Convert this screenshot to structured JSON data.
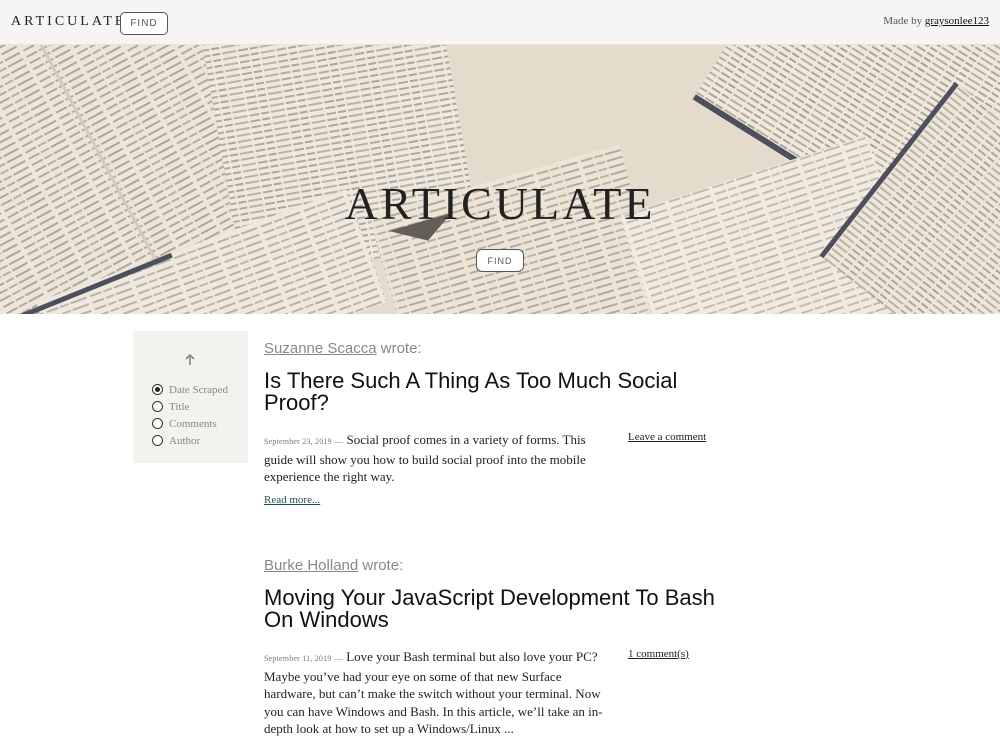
{
  "nav": {
    "brand": "ARTICULATE",
    "find_label": "FIND",
    "made_by_prefix": "Made by",
    "made_by_user": "graysonlee123"
  },
  "hero": {
    "title": "ARTICULATE",
    "find_label": "FIND"
  },
  "sort": {
    "direction_icon": "arrow-up-icon",
    "options": [
      {
        "label": "Date Scraped",
        "selected": true
      },
      {
        "label": "Title",
        "selected": false
      },
      {
        "label": "Comments",
        "selected": false
      },
      {
        "label": "Author",
        "selected": false
      }
    ]
  },
  "articles": [
    {
      "author": "Suzanne Scacca",
      "wrote": "wrote:",
      "title": "Is There Such A Thing As Too Much Social Proof?",
      "date": "September 23, 2019",
      "separator": "—",
      "summary": "Social proof comes in a variety of forms. This guide will show you how to build social proof into the mobile experience the right way.",
      "comments": "Leave a comment",
      "read_more": "Read more..."
    },
    {
      "author": "Burke Holland",
      "wrote": "wrote:",
      "title": "Moving Your JavaScript Development To Bash On Windows",
      "date": "September 11, 2019",
      "separator": "—",
      "summary": "Love your Bash terminal but also love your PC? Maybe you’ve had your eye on some of that new Surface hardware, but can’t make the switch without your terminal. Now you can have Windows and Bash. In this article, we’ll take an in-depth look at how to set up a Windows/Linux ...",
      "comments": "1 comment(s)",
      "read_more": ""
    }
  ],
  "colors": {
    "nav_bg": "#f6f5f3",
    "panel_bg": "#f3f2ef",
    "link": "#1f4f5c",
    "muted": "#888888"
  }
}
